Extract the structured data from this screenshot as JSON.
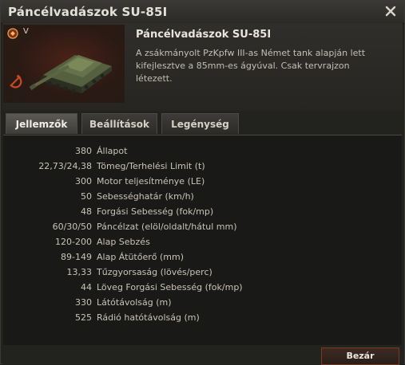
{
  "window": {
    "title": "Páncélvadászok SU-85I"
  },
  "vehicle": {
    "tier": "V",
    "name": "Páncélvadászok SU-85I",
    "description": "A zsákmányolt PzKpfw III-as Német tank alapján lett kifejlesztve a 85mm-es ágyúval. Csak tervrajzon létezett."
  },
  "tabs": [
    {
      "label": "Jellemzők",
      "active": true
    },
    {
      "label": "Beállítások",
      "active": false
    },
    {
      "label": "Legénység",
      "active": false
    }
  ],
  "stats": [
    {
      "value": "380",
      "label": "Állapot"
    },
    {
      "value": "22,73/24,38",
      "label": "Tömeg/Terhelési Limit (t)"
    },
    {
      "value": "300",
      "label": "Motor teljesítménye (LE)"
    },
    {
      "value": "50",
      "label": "Sebességhatár (km/h)"
    },
    {
      "value": "48",
      "label": "Forgási Sebesség (fok/mp)"
    },
    {
      "value": "60/30/50",
      "label": "Páncélzat (elöl/oldalt/hátul mm)"
    },
    {
      "value": "120-200",
      "label": "Alap Sebzés"
    },
    {
      "value": "89-149",
      "label": "Alap Átütőerő (mm)"
    },
    {
      "value": "13,33",
      "label": "Tűzgyorsaság (lövés/perc)"
    },
    {
      "value": "44",
      "label": "Löveg Forgási Sebesség (fok/mp)"
    },
    {
      "value": "330",
      "label": "Látótávolság (m)"
    },
    {
      "value": "525",
      "label": "Rádió hatótávolság (m)"
    }
  ],
  "footer": {
    "close_label": "Bezár"
  },
  "icons": {
    "close": "close-icon",
    "badge": "nation-badge-icon",
    "sickle": "hammer-sickle-icon"
  }
}
